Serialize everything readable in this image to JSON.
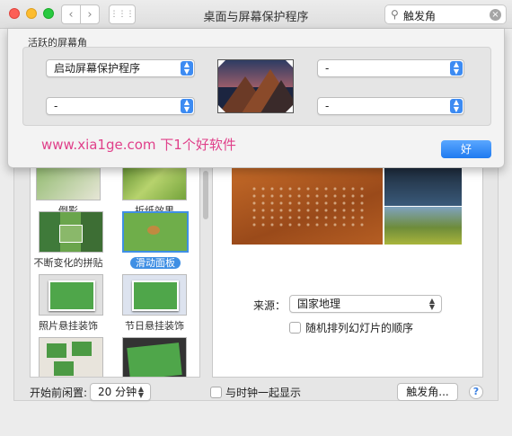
{
  "window": {
    "title": "桌面与屏幕保护程序"
  },
  "search": {
    "value": "触发角",
    "clear_glyph": "×"
  },
  "nav": {
    "back": "‹",
    "forward": "›",
    "grid": "⋮⋮⋮"
  },
  "sheet": {
    "group_title": "活跃的屏幕角",
    "top_left": "启动屏幕保护程序",
    "bottom_left": "-",
    "top_right": "-",
    "bottom_right": "-",
    "ok_label": "好"
  },
  "watermark": "www.xia1ge.com 下1个好软件",
  "screensavers": [
    {
      "label": "倒影"
    },
    {
      "label": "折纸效果"
    },
    {
      "label": "不断变化的拼贴"
    },
    {
      "label": "滑动面板",
      "selected": true
    },
    {
      "label": "照片悬挂装饰"
    },
    {
      "label": "节日悬挂装饰"
    }
  ],
  "options": {
    "source_label": "来源：",
    "source_value": "国家地理",
    "shuffle_label": "随机排列幻灯片的顺序"
  },
  "footer": {
    "idle_label": "开始前闲置:",
    "idle_value": "20 分钟",
    "clock_label": "与时钟一起显示",
    "hot_corners_label": "触发角...",
    "help_glyph": "?"
  },
  "colors": {
    "accent": "#3d8bf2",
    "watermark": "#e0408a"
  }
}
